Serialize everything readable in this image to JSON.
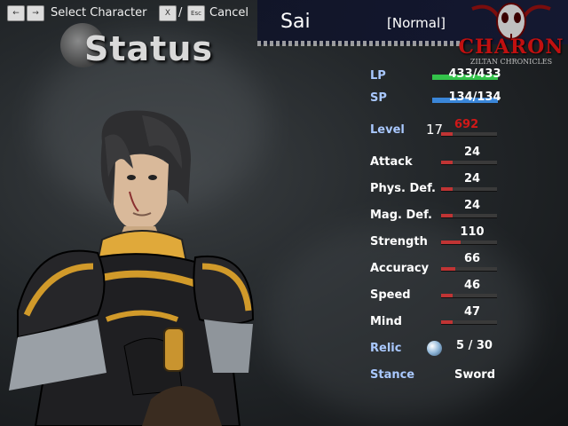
{
  "controls": {
    "left_key": "←",
    "right_key": "→",
    "select_label": "Select Character",
    "x_key": "X",
    "slash": "/",
    "esc_key": "Esc",
    "cancel_label": "Cancel"
  },
  "screen_title": "Status",
  "character": {
    "name": "Sai",
    "state": "[Normal]"
  },
  "logo": {
    "title": "CHARON",
    "subtitle": "ZILTAN CHRONICLES"
  },
  "stats": {
    "lp": {
      "label": "LP",
      "value": "433/433",
      "current": 433,
      "max": 433,
      "color": "#33c24a"
    },
    "sp": {
      "label": "SP",
      "value": "134/134",
      "current": 134,
      "max": 134,
      "color": "#3a86d8"
    },
    "level": {
      "label": "Level",
      "value": "17",
      "exp": "692",
      "exp_color": "#d01818"
    },
    "list": [
      {
        "label": "Attack",
        "value": "24",
        "fill": 0.2
      },
      {
        "label": "Phys. Def.",
        "value": "24",
        "fill": 0.2
      },
      {
        "label": "Mag. Def.",
        "value": "24",
        "fill": 0.2
      },
      {
        "label": "Strength",
        "value": "110",
        "fill": 0.35
      },
      {
        "label": "Accuracy",
        "value": "66",
        "fill": 0.25
      },
      {
        "label": "Speed",
        "value": "46",
        "fill": 0.2
      },
      {
        "label": "Mind",
        "value": "47",
        "fill": 0.2
      }
    ],
    "relic": {
      "label": "Relic",
      "value": "5 / 30"
    },
    "stance": {
      "label": "Stance",
      "value": "Sword"
    }
  }
}
